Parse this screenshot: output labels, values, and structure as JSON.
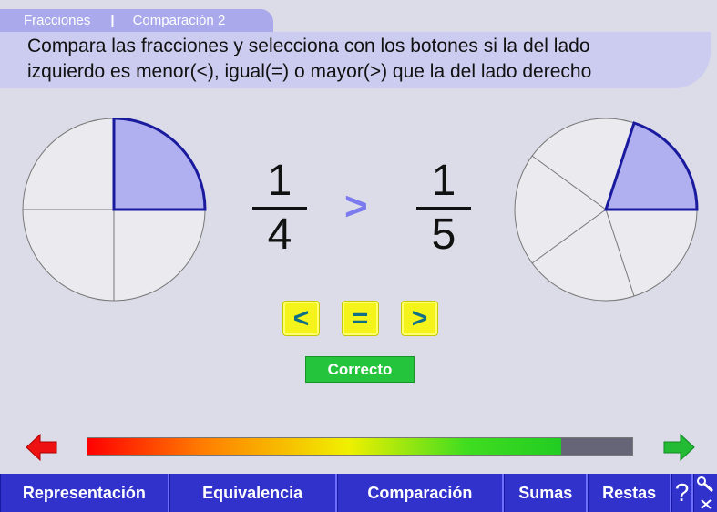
{
  "breadcrumb": {
    "section": "Fracciones",
    "separator": "|",
    "subsection": "Comparación 2"
  },
  "instruction": {
    "line1": "Compara las fracciones y selecciona con los botones si la del lado",
    "line2": "izquierdo es menor(<), igual(=) o mayor(>) que la del lado derecho"
  },
  "left_fraction": {
    "numerator": "1",
    "denominator": "4"
  },
  "right_fraction": {
    "numerator": "1",
    "denominator": "5"
  },
  "comparison_shown": ">",
  "buttons": {
    "less": "<",
    "equal": "=",
    "greater": ">"
  },
  "result": "Correcto",
  "progress": {
    "fraction": 0.87
  },
  "nav": [
    "Representación",
    "Equivalencia",
    "Comparación",
    "Sumas",
    "Restas"
  ],
  "help_label": "?",
  "colors": {
    "accent": "#3131cc",
    "pie_highlight": "#b0b0f0",
    "progress_empty": "#666577"
  },
  "icons": {
    "prev": "arrow-left-icon",
    "next": "arrow-right-icon",
    "tools": "wrench-icon",
    "close": "close-icon"
  }
}
